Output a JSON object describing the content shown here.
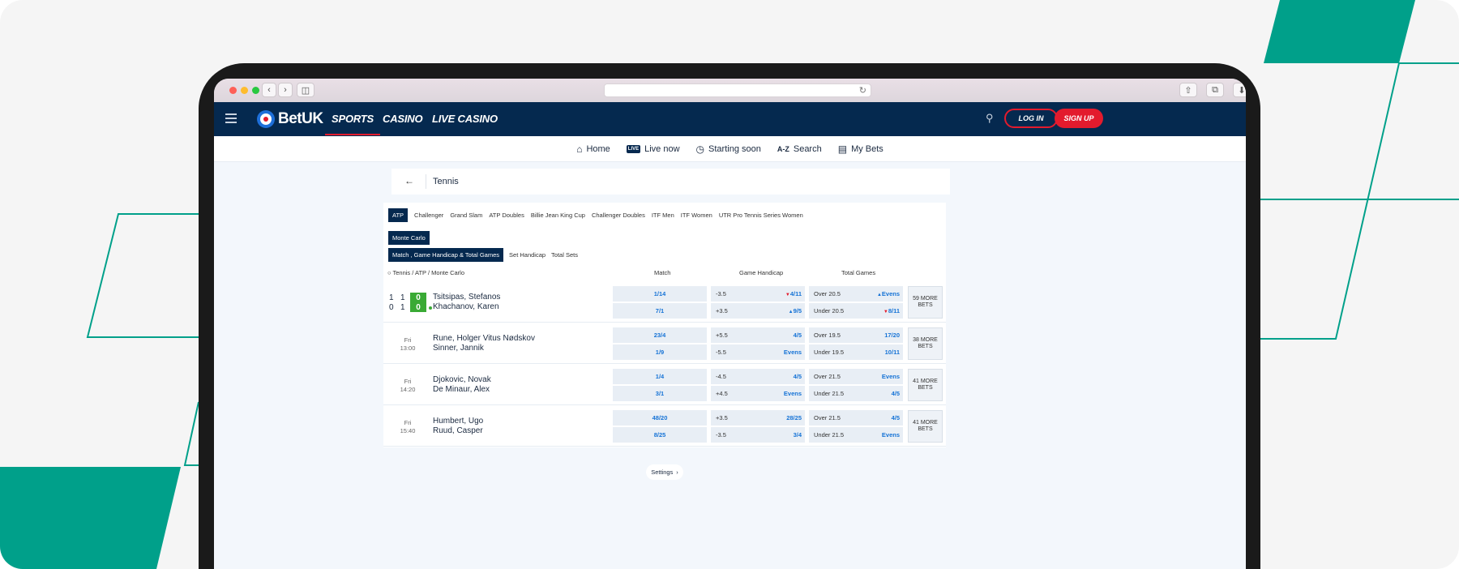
{
  "browser": {
    "reload_icon": "reload-icon"
  },
  "site": {
    "brand": "BetUK",
    "nav": [
      "SPORTS",
      "CASINO",
      "LIVE CASINO"
    ],
    "login_label": "LOG IN",
    "signup_label": "SIGN UP"
  },
  "subnav": [
    {
      "label": "Home",
      "icon": "home-icon"
    },
    {
      "label": "Live now",
      "icon": "live-icon",
      "tag": "LIVE"
    },
    {
      "label": "Starting soon",
      "icon": "clock-icon"
    },
    {
      "label": "Search",
      "icon": "az-icon",
      "tag": "A-Z"
    },
    {
      "label": "My Bets",
      "icon": "receipt-icon"
    }
  ],
  "page": {
    "title": "Tennis"
  },
  "tabs": [
    "ATP",
    "Challenger",
    "Grand Slam",
    "ATP Doubles",
    "Billie Jean King Cup",
    "Challenger Doubles",
    "ITF Men",
    "ITF Women",
    "UTR Pro Tennis Series Women"
  ],
  "tournament": "Monte Carlo",
  "market_tabs": [
    "Match , Game Handicap & Total Games",
    "Set Handicap",
    "Total Sets"
  ],
  "breadcrumb": "Tennis / ATP / Monte Carlo",
  "columns": [
    "Match",
    "Game Handicap",
    "Total Games"
  ],
  "events": [
    {
      "live": true,
      "sets": [
        [
          "1",
          "1"
        ],
        [
          "0",
          "1"
        ]
      ],
      "games": [
        "0",
        "0"
      ],
      "players": [
        "Tsitsipas, Stefanos",
        "Khachanov, Karen"
      ],
      "match": [
        "1/14",
        "7/1"
      ],
      "handicap": [
        [
          "-3.5",
          "4/11"
        ],
        [
          "+3.5",
          "9/5"
        ]
      ],
      "totals": [
        [
          "Over  20.5",
          "Evens"
        ],
        [
          "Under  20.5",
          "8/11"
        ]
      ],
      "more": "59 MORE BETS"
    },
    {
      "day": "Fri",
      "time": "13:00",
      "players": [
        "Rune, Holger Vitus Nødskov",
        "Sinner, Jannik"
      ],
      "match": [
        "23/4",
        "1/9"
      ],
      "handicap": [
        [
          "+5.5",
          "4/5"
        ],
        [
          "-5.5",
          "Evens"
        ]
      ],
      "totals": [
        [
          "Over  19.5",
          "17/20"
        ],
        [
          "Under  19.5",
          "10/11"
        ]
      ],
      "more": "38 MORE BETS"
    },
    {
      "day": "Fri",
      "time": "14:20",
      "players": [
        "Djokovic, Novak",
        "De Minaur, Alex"
      ],
      "match": [
        "1/4",
        "3/1"
      ],
      "handicap": [
        [
          "-4.5",
          "4/5"
        ],
        [
          "+4.5",
          "Evens"
        ]
      ],
      "totals": [
        [
          "Over  21.5",
          "Evens"
        ],
        [
          "Under  21.5",
          "4/5"
        ]
      ],
      "more": "41 MORE BETS"
    },
    {
      "day": "Fri",
      "time": "15:40",
      "players": [
        "Humbert, Ugo",
        "Ruud, Casper"
      ],
      "match": [
        "48/20",
        "8/25"
      ],
      "handicap": [
        [
          "+3.5",
          "28/25"
        ],
        [
          "-3.5",
          "3/4"
        ]
      ],
      "totals": [
        [
          "Over  21.5",
          "4/5"
        ],
        [
          "Under  21.5",
          "Evens"
        ]
      ],
      "more": "41 MORE BETS"
    }
  ],
  "settings_label": "Settings",
  "colors": {
    "navy": "#05294f",
    "red": "#e31b2d",
    "teal": "#00a08a",
    "odds_blue": "#1673d6",
    "live_green": "#3aaa35"
  }
}
